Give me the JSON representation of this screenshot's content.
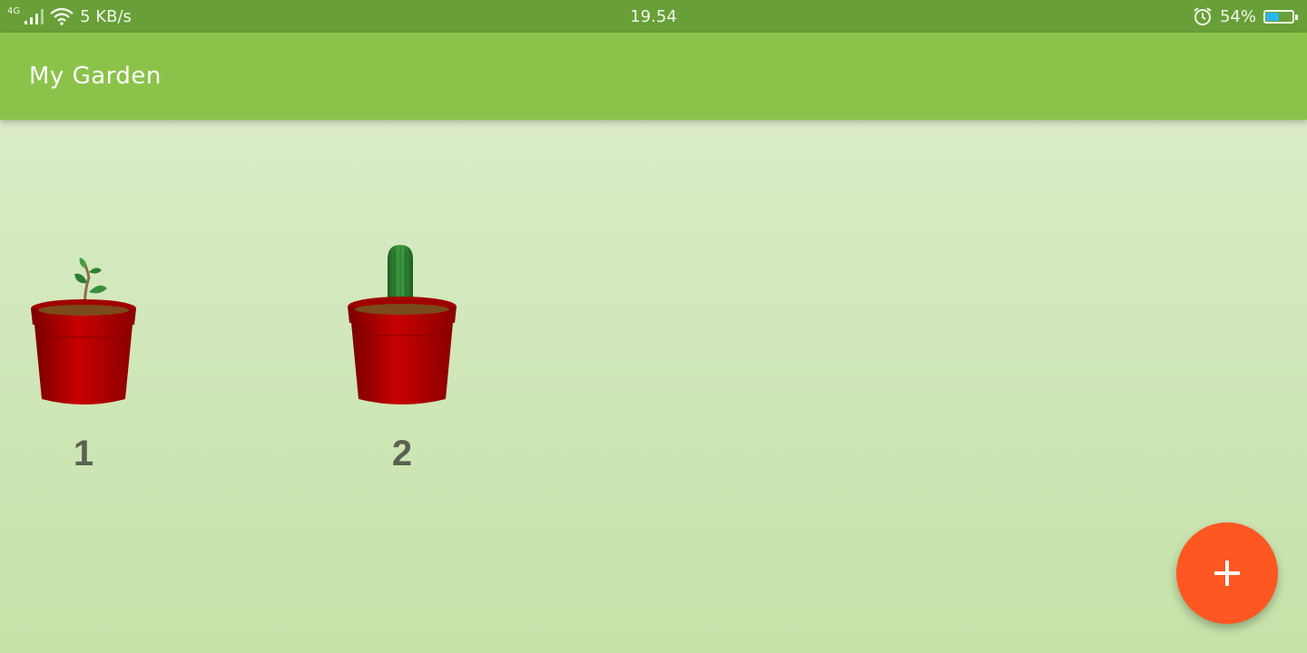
{
  "status_bar": {
    "network": "4G",
    "speed": "5 KB/s",
    "time": "19.54",
    "battery_percent": "54%",
    "battery_level": 0.54,
    "icons": [
      "signal-icon",
      "wifi-icon",
      "alarm-icon",
      "battery-icon"
    ]
  },
  "app_bar": {
    "title": "My Garden"
  },
  "garden": {
    "plants": [
      {
        "label": "1",
        "plant": "sprout",
        "pot": "red-pot"
      },
      {
        "label": "2",
        "plant": "cactus",
        "pot": "red-pot"
      }
    ]
  },
  "fab": {
    "icon": "plus-icon",
    "color": "#ff5722"
  },
  "colors": {
    "status_bar": "#689f38",
    "app_bar": "#8bc34a",
    "pot": "#c40000",
    "accent": "#ff5722"
  }
}
